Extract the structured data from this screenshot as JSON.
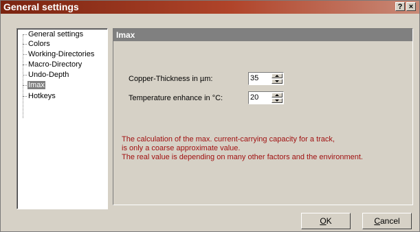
{
  "window": {
    "title": "General settings",
    "help_label": "?",
    "close_label": "×"
  },
  "tree": {
    "items": [
      {
        "label": "General settings",
        "selected": false
      },
      {
        "label": "Colors",
        "selected": false
      },
      {
        "label": "Working-Directories",
        "selected": false
      },
      {
        "label": "Macro-Directory",
        "selected": false
      },
      {
        "label": "Undo-Depth",
        "selected": false
      },
      {
        "label": "Imax",
        "selected": true
      },
      {
        "label": "Hotkeys",
        "selected": false
      }
    ]
  },
  "panel": {
    "title": "Imax",
    "fields": [
      {
        "label": "Copper-Thickness in µm:",
        "value": "35"
      },
      {
        "label": "Temperature enhance in °C:",
        "value": "20"
      }
    ],
    "note_lines": [
      "The calculation of the max. current-carrying capacity for a track,",
      "is only a coarse approximate value.",
      "The real value is depending on many other factors and the environment."
    ],
    "note_color": "#a01010"
  },
  "buttons": {
    "ok_mnemonic": "O",
    "ok_rest": "K",
    "cancel_mnemonic": "C",
    "cancel_rest": "ancel"
  }
}
